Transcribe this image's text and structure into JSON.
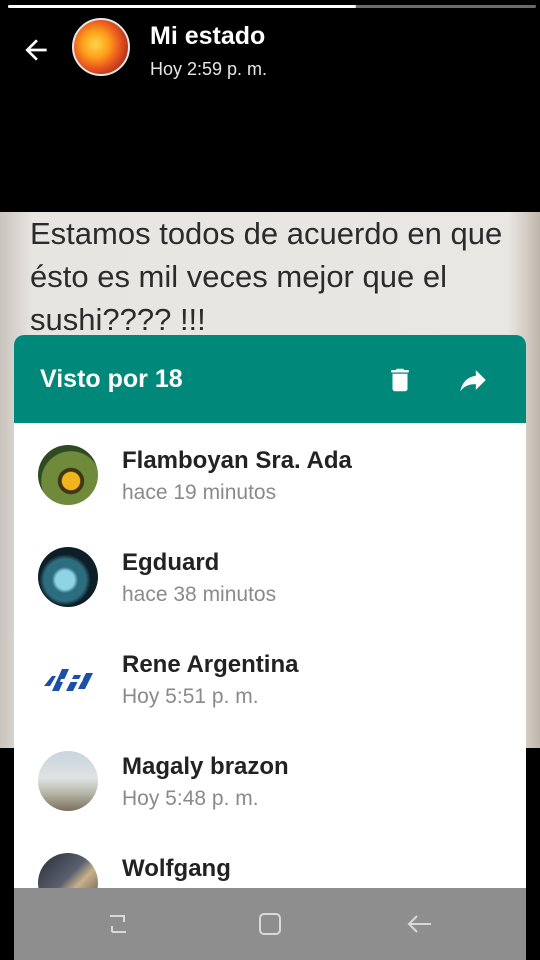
{
  "header": {
    "title": "Mi estado",
    "subtitle": "Hoy 2:59 p. m.",
    "back_icon": "arrow-left-icon",
    "progress": 0.66
  },
  "status": {
    "text": "Estamos todos de acuerdo en que ésto es mil veces mejor que el sushi???? !!!"
  },
  "viewers_sheet": {
    "title": "Visto por 18",
    "accent_color": "#00897b",
    "delete_icon": "trash-icon",
    "forward_icon": "share-forward-icon",
    "viewers": [
      {
        "name": "Flamboyan Sra. Ada",
        "time": "hace 19 minutos"
      },
      {
        "name": "Egduard",
        "time": "hace 38 minutos"
      },
      {
        "name": "Rene Argentina",
        "time": "Hoy 5:51 p. m."
      },
      {
        "name": "Magaly brazon",
        "time": "Hoy 5:48 p. m."
      },
      {
        "name": "Wolfgang",
        "time": ""
      }
    ]
  },
  "navbar": {
    "recents_icon": "recents-icon",
    "home_icon": "home-icon",
    "back_icon": "nav-back-icon"
  }
}
